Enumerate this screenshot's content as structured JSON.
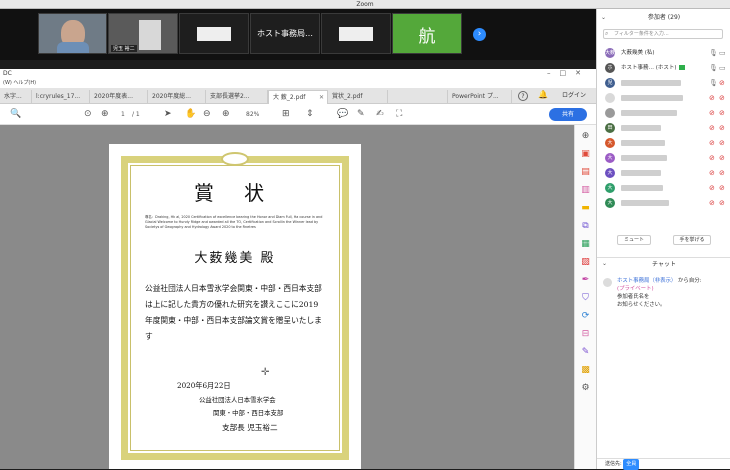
{
  "zoom": {
    "title": "Zoom",
    "tiles": [
      {
        "name": "",
        "label": "",
        "kind": "video"
      },
      {
        "name": "",
        "label": "児玉 裕二",
        "kind": "video"
      },
      {
        "name": "",
        "label": "",
        "kind": "hidden"
      },
      {
        "name": "ホスト事務局…",
        "label": "",
        "kind": "name"
      },
      {
        "name": "",
        "label": "",
        "kind": "hidden"
      },
      {
        "name": "航",
        "label": "",
        "kind": "green"
      }
    ],
    "next_icon": "›"
  },
  "pdf_app": {
    "window_title": "DC",
    "window_controls": "–□✕",
    "menu": "(W)  ヘルプ(H)",
    "tabs": [
      {
        "label": "水字..."
      },
      {
        "label": "l:cryrules_17..."
      },
      {
        "label": "2020年度表..."
      },
      {
        "label": "2020年度総..."
      },
      {
        "label": "支部長選挙2..."
      },
      {
        "label": "大 薮_2.pdf",
        "active": true
      },
      {
        "label": "賞状_2.pdf"
      },
      {
        "label": ""
      },
      {
        "label": "PowerPoint プ..."
      }
    ],
    "login": "ログイン",
    "help": "?",
    "share": "共有",
    "page_current": "1",
    "page_total": "/ 1",
    "zoom_level": "82%"
  },
  "certificate": {
    "title": "賞 状",
    "small_text": "尊名：Draking, Hk al, 2020 Certification of excellence bearing the Honor and Diam Full, Ha course in and Glacial Welcome to Hundy Ridge and awarded all the TO, Certification and Scrollin the Winner lead by Societys of Geography and Hydrology Award 2020 to the Rnetres",
    "recipient": "大薮幾美 殿",
    "body": "公益社団法人日本雪氷学会関東・中部・西日本支部は上に記した貴方の優れた研究を讃えここに2019年度関東・中部・西日本支部論文賞を贈呈いたします",
    "date": "2020年6月22日",
    "org": "公益社団法人日本雪氷学会",
    "org_sub": "関東・中部・西日本支部",
    "signer": "支部長 児玉裕二"
  },
  "participants_panel": {
    "header": "参加者 (29)",
    "search_placeholder": "フィルター条件を入力...",
    "participants": [
      {
        "initials": "大薮",
        "name": "大薮幾美 (私)",
        "color": "#8a6bb8",
        "mic_muted": false,
        "cam_muted": false
      },
      {
        "initials": "ホ",
        "name": "ホスト事務… (ホスト)",
        "color": "#555555",
        "mic_muted": false,
        "cam_muted": false
      },
      {
        "initials": "児",
        "name": "",
        "color": "#3f5e8f",
        "mic_muted": false,
        "cam_muted": true
      },
      {
        "initials": "",
        "name": "",
        "color": "#d9d9d9",
        "mic_muted": true,
        "cam_muted": true
      },
      {
        "initials": "",
        "name": "",
        "color": "#9a9a9a",
        "mic_muted": true,
        "cam_muted": true
      },
      {
        "initials": "田",
        "name": "",
        "color": "#4b6f44",
        "mic_muted": true,
        "cam_muted": true
      },
      {
        "initials": "大",
        "name": "",
        "color": "#d5572b",
        "mic_muted": true,
        "cam_muted": true
      },
      {
        "initials": "大",
        "name": "",
        "color": "#9b5cc5",
        "mic_muted": true,
        "cam_muted": true
      },
      {
        "initials": "大",
        "name": "",
        "color": "#6c4fc0",
        "mic_muted": true,
        "cam_muted": true
      },
      {
        "initials": "大",
        "name": "",
        "color": "#2e9e6a",
        "mic_muted": true,
        "cam_muted": true
      },
      {
        "initials": "大",
        "name": "",
        "color": "#2e8a55",
        "mic_muted": true,
        "cam_muted": true
      }
    ],
    "mute_button": "ミュート",
    "raise_hand_button": "手を挙げる"
  },
  "chat": {
    "header": "チャット",
    "from": "ホスト事務局（非表示）",
    "from_suffix": "から自分:",
    "private_label": "(プライベート)",
    "message_line1": "参加者氏名を",
    "message_line2": "お知らせください。",
    "footer_label": "送信先:",
    "footer_target": "全員"
  }
}
